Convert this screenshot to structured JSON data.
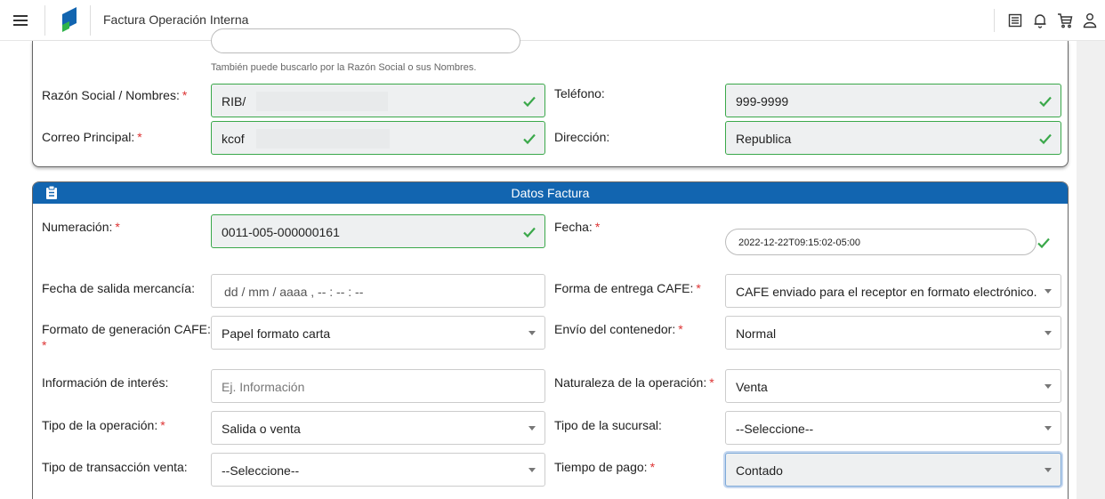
{
  "header": {
    "title": "Factura Operación Interna"
  },
  "client": {
    "search_hint": "También puede buscarlo por la Razón Social o sus Nombres.",
    "razon_label": "Razón Social / Nombres:",
    "razon_value": "RIB/",
    "correo_label": "Correo Principal:",
    "correo_value": "kcof",
    "telefono_label": "Teléfono:",
    "telefono_value": "999-9999",
    "direccion_label": "Dirección:",
    "direccion_value": "Republica"
  },
  "factura": {
    "title": "Datos Factura",
    "numeracion_label": "Numeración:",
    "numeracion_value": "0011-005-000000161",
    "fecha_label": "Fecha:",
    "fecha_value": "2022-12-22T09:15:02-05:00",
    "fecha_salida_label": "Fecha de salida mercancía:",
    "fecha_salida_placeholder": "dd / mm / aaaa ,  -- : -- : --",
    "forma_entrega_label": "Forma de entrega CAFE:",
    "forma_entrega_value": "CAFE enviado para el receptor en formato electrónico.",
    "formato_label": "Formato de generación CAFE:",
    "formato_value": "Papel formato carta",
    "envio_label": "Envío del contenedor:",
    "envio_value": "Normal",
    "info_label": "Información de interés:",
    "info_placeholder": "Ej. Información",
    "naturaleza_label": "Naturaleza de la operación:",
    "naturaleza_value": "Venta",
    "tipo_operacion_label": "Tipo de la operación:",
    "tipo_operacion_value": "Salida o venta",
    "tipo_sucursal_label": "Tipo de la sucursal:",
    "tipo_sucursal_value": "--Seleccione--",
    "tipo_transaccion_label": "Tipo de transacción venta:",
    "tipo_transaccion_value": "--Seleccione--",
    "tiempo_pago_label": "Tiempo de pago:",
    "tiempo_pago_value": "Contado"
  },
  "required_mark": "*",
  "colors": {
    "header_blue": "#1265b0",
    "valid_green": "#3aa84a",
    "required_red": "#d33333"
  }
}
